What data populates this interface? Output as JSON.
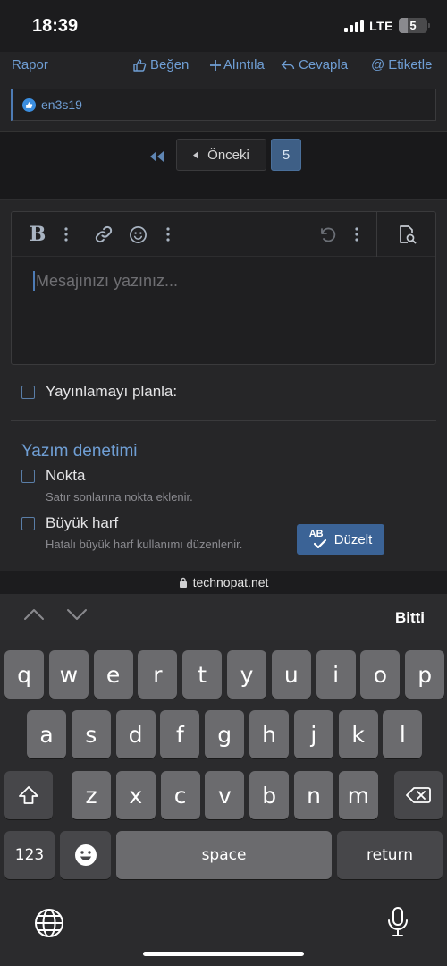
{
  "status_bar": {
    "time": "18:39",
    "network": "LTE",
    "battery_level": "5"
  },
  "post_actions": {
    "report": "Rapor",
    "like": "Beğen",
    "quote": "Alıntıla",
    "reply": "Cevapla",
    "tag": "Etiketle"
  },
  "reactions": {
    "user": "en3s19"
  },
  "pagination": {
    "previous_label": "Önceki",
    "current_page": "5"
  },
  "editor": {
    "placeholder": "Mesajınızı yazınız..."
  },
  "options": {
    "schedule_label": "Yayınlamayı planla:",
    "spellcheck_title": "Yazım denetimi",
    "period_label": "Nokta",
    "period_hint": "Satır sonlarına nokta eklenir.",
    "capital_label": "Büyük harf",
    "capital_hint": "Hatalı büyük harf kullanımı düzenlenir.",
    "fix_button": "Düzelt",
    "fix_icon_text": "AB"
  },
  "browser": {
    "url": "technopat.net"
  },
  "keyboard": {
    "done": "Bitti",
    "row1": [
      "q",
      "w",
      "e",
      "r",
      "t",
      "y",
      "u",
      "i",
      "o",
      "p"
    ],
    "row2": [
      "a",
      "s",
      "d",
      "f",
      "g",
      "h",
      "j",
      "k",
      "l"
    ],
    "row3": [
      "z",
      "x",
      "c",
      "v",
      "b",
      "n",
      "m"
    ],
    "numbers_key": "123",
    "space_key": "space",
    "return_key": "return"
  },
  "colors": {
    "accent": "#6f9ed4",
    "primary_button": "#3b6396",
    "page_active": "#3e5f86"
  }
}
